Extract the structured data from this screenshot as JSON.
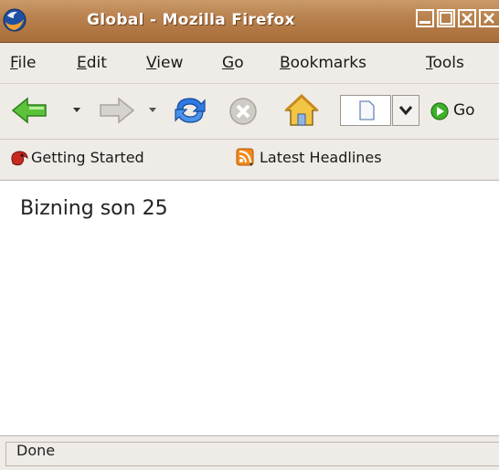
{
  "window": {
    "title": "Global - Mozilla Firefox"
  },
  "menu": {
    "items": [
      {
        "label": "File",
        "key": "F",
        "rest": "ile"
      },
      {
        "label": "Edit",
        "key": "E",
        "rest": "dit"
      },
      {
        "label": "View",
        "key": "V",
        "rest": "iew"
      },
      {
        "label": "Go",
        "key": "G",
        "rest": "o"
      },
      {
        "label": "Bookmarks",
        "key": "B",
        "rest": "ookmarks"
      },
      {
        "label": "Tools",
        "key": "T",
        "rest": "ools"
      }
    ]
  },
  "toolbar": {
    "go_label": "Go",
    "icons": [
      "back-icon",
      "forward-icon",
      "reload-icon",
      "stop-icon",
      "home-icon",
      "page-icon",
      "go-icon"
    ]
  },
  "bookmarks": {
    "items": [
      {
        "label": "Getting Started",
        "icon": "firefox-bookmark-icon"
      },
      {
        "label": "Latest Headlines",
        "icon": "rss-feed-icon"
      }
    ]
  },
  "page": {
    "text": "Bizning son 25"
  },
  "status": {
    "text": "Done"
  },
  "colors": {
    "titlebar": "#b9824e",
    "chrome": "#efebe7",
    "back_arrow": "#3fae2a",
    "reload": "#2a6fd6"
  }
}
